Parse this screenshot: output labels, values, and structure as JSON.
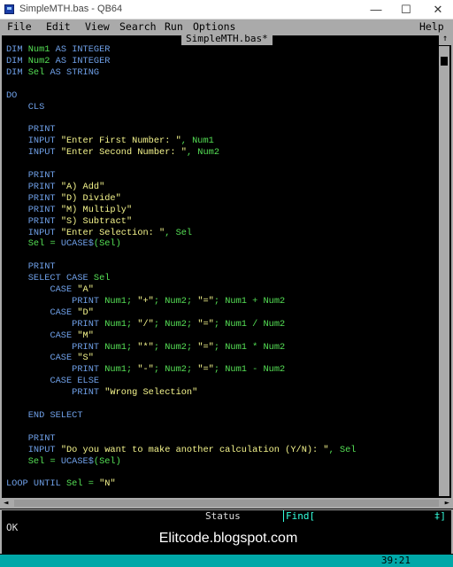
{
  "window": {
    "title": "SimpleMTH.bas - QB64",
    "min_glyph": "—",
    "max_glyph": "☐",
    "close_glyph": "✕"
  },
  "menu": [
    "File",
    "Edit",
    "View",
    "Search",
    "Run",
    "Options",
    "Help"
  ],
  "editor": {
    "tab_title": "SimpleMTH.bas*",
    "lines": [
      "DIM Num1 AS INTEGER",
      "DIM Num2 AS INTEGER",
      "DIM Sel AS STRING",
      "",
      "DO",
      "    CLS",
      "",
      "    PRINT",
      "    INPUT \"Enter First Number: \", Num1",
      "    INPUT \"Enter Second Number: \", Num2",
      "",
      "    PRINT",
      "    PRINT \"A) Add\"",
      "    PRINT \"D) Divide\"",
      "    PRINT \"M) Multiply\"",
      "    PRINT \"S) Subtract\"",
      "    INPUT \"Enter Selection: \", Sel",
      "    Sel = UCASE$(Sel)",
      "",
      "    PRINT",
      "    SELECT CASE Sel",
      "        CASE \"A\"",
      "            PRINT Num1; \"+\"; Num2; \"=\"; Num1 + Num2",
      "        CASE \"D\"",
      "            PRINT Num1; \"/\"; Num2; \"=\"; Num1 / Num2",
      "        CASE \"M\"",
      "            PRINT Num1; \"*\"; Num2; \"=\"; Num1 * Num2",
      "        CASE \"S\"",
      "            PRINT Num1; \"-\"; Num2; \"=\"; Num1 - Num2",
      "        CASE ELSE",
      "            PRINT \"Wrong Selection\"",
      "",
      "    END SELECT",
      "",
      "    PRINT",
      "    INPUT \"Do you want to make another calculation (Y/N): \", Sel",
      "    Sel = UCASE$(Sel)",
      "",
      "LOOP UNTIL Sel = \"N\""
    ]
  },
  "status_bar": {
    "label": "Status",
    "find_label": "Find[",
    "find_end": "‡]"
  },
  "immediate": {
    "text": "OK",
    "watermark": "Elitcode.blogspot.com"
  },
  "bottom": {
    "cursor": "39:21"
  },
  "colors": {
    "keyword": "#6fa0e8",
    "variable": "#55e055",
    "string": "#f5f58c",
    "bottom_bar": "#00a8a8"
  }
}
